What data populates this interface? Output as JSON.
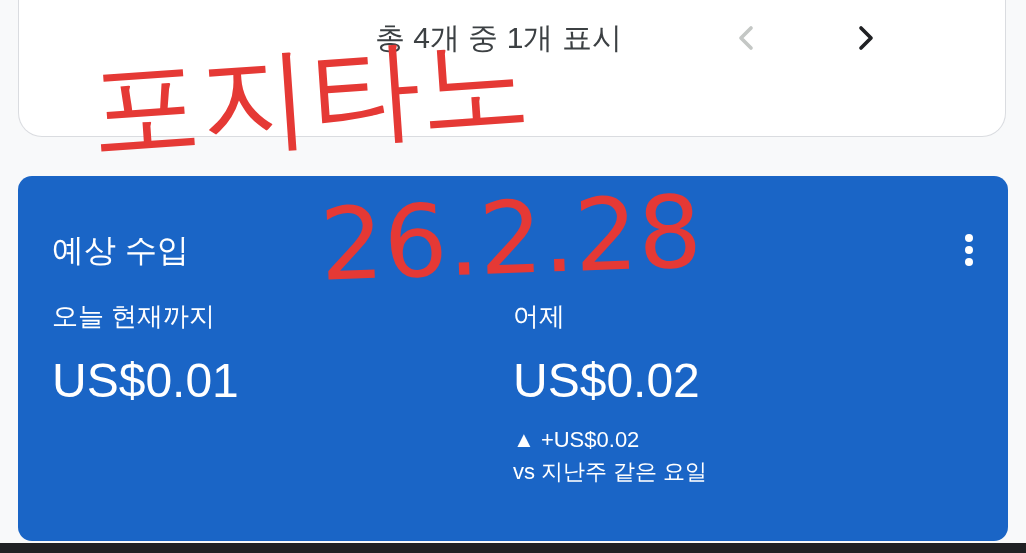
{
  "pager": {
    "label": "총 4개 중 1개 표시",
    "prev": {
      "disabled": true
    },
    "next": {
      "disabled": false
    }
  },
  "earnings_card": {
    "title": "예상 수입",
    "metrics": [
      {
        "label": "오늘 현재까지",
        "value": "US$0.01"
      },
      {
        "label": "어제",
        "value": "US$0.02",
        "change": "▲ +US$0.02",
        "comparison": "vs 지난주 같은 요일"
      }
    ]
  },
  "annotations": [
    {
      "text": "포지타노"
    },
    {
      "text": "26.2.28"
    }
  ]
}
